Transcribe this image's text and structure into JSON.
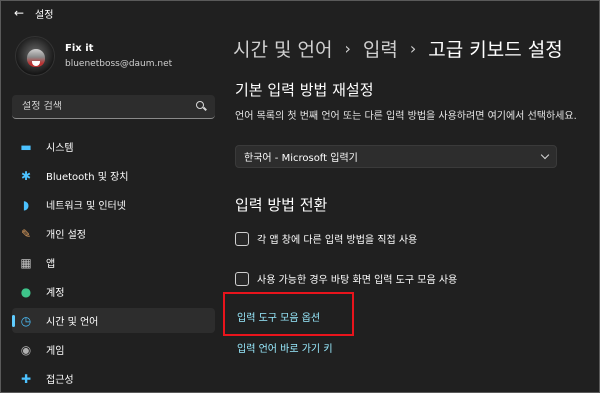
{
  "window": {
    "title": "설정",
    "back_icon": "back-arrow-icon"
  },
  "profile": {
    "name": "Fix it",
    "email": "bluenetboss@daum.net"
  },
  "search": {
    "placeholder": "설정 검색",
    "icon": "search-icon"
  },
  "sidebar": {
    "items": [
      {
        "label": "시스템",
        "icon": "monitor-icon",
        "glyph": "▬",
        "color": "#4cc2ff"
      },
      {
        "label": "Bluetooth 및 장치",
        "icon": "bluetooth-icon",
        "glyph": "✱",
        "color": "#4cc2ff"
      },
      {
        "label": "네트워크 및 인터넷",
        "icon": "wifi-icon",
        "glyph": "◗",
        "color": "#4cc2ff"
      },
      {
        "label": "개인 설정",
        "icon": "paintbrush-icon",
        "glyph": "🖌",
        "color": "#e0a060"
      },
      {
        "label": "앱",
        "icon": "apps-icon",
        "glyph": "▦",
        "color": "#c0c0c0"
      },
      {
        "label": "계정",
        "icon": "account-icon",
        "glyph": "●",
        "color": "#3ec48a"
      },
      {
        "label": "시간 및 언어",
        "icon": "time-language-icon",
        "glyph": "◷",
        "color": "#4cc2ff",
        "active": true
      },
      {
        "label": "게임",
        "icon": "gamepad-icon",
        "glyph": "◉",
        "color": "#b0b0b0"
      },
      {
        "label": "접근성",
        "icon": "accessibility-icon",
        "glyph": "✚",
        "color": "#4cc2ff"
      }
    ]
  },
  "breadcrumb": {
    "items": [
      "시간 및 언어",
      "입력",
      "고급 키보드 설정"
    ],
    "separator": "›"
  },
  "section_default_input": {
    "title": "기본 입력 방법 재설정",
    "description": "언어 목록의 첫 번째 언어 또는 다른 입력 방법을 사용하려면 여기에서 선택하세요.",
    "dropdown_value": "한국어 - Microsoft 입력기"
  },
  "section_switching": {
    "title": "입력 방법 전환",
    "checkbox_per_app": "각 앱 창에 다른 입력 방법을 직접 사용",
    "checkbox_desktop_toolbar": "사용 가능한 경우 바탕 화면 입력 도구 모음 사용",
    "link_toolbar_options": "입력 도구 모음 옵션",
    "link_hotkeys": "입력 언어 바로 가기 키"
  },
  "colors": {
    "background": "#202020",
    "accent": "#60cdff",
    "link": "#99ebff",
    "highlight": "#e8141c"
  }
}
